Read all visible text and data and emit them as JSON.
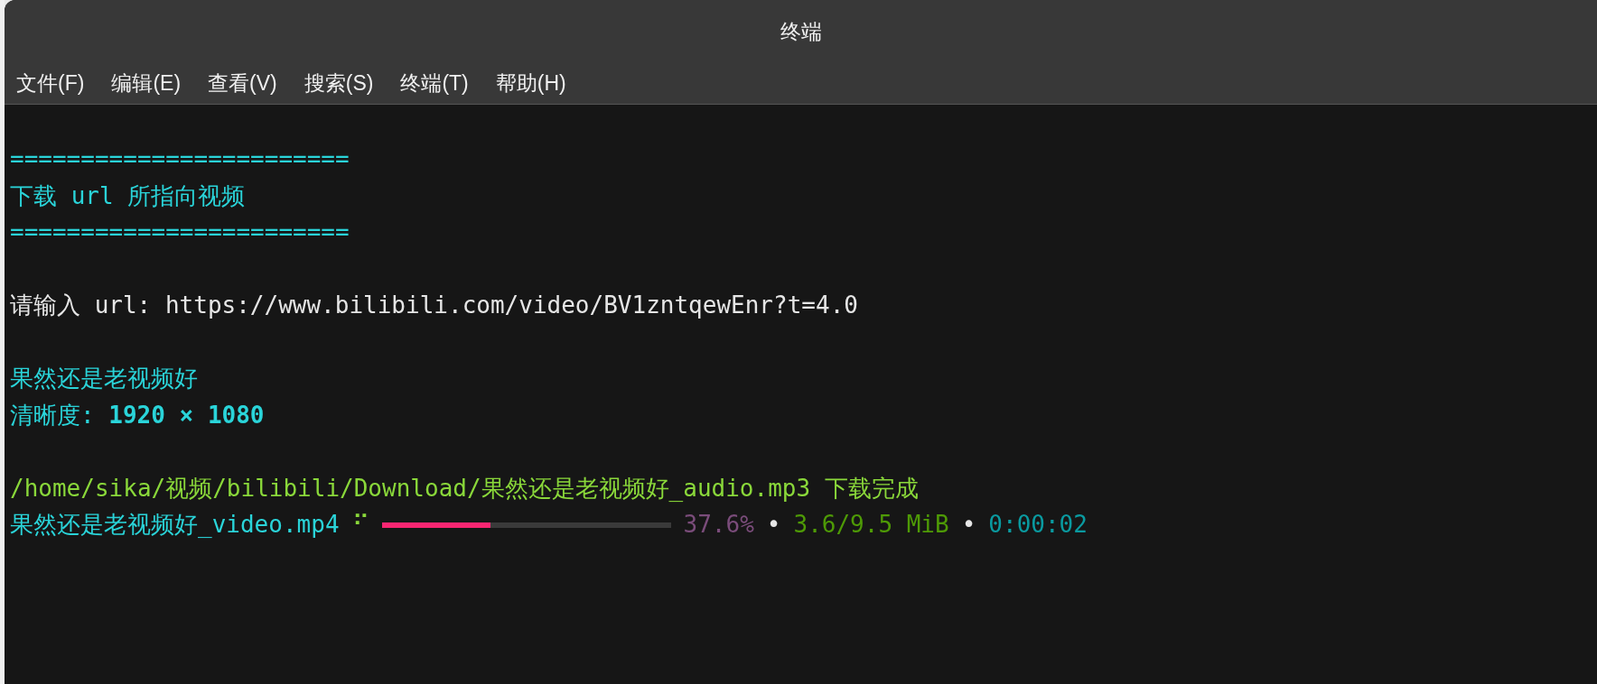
{
  "window": {
    "title": "终端"
  },
  "menu": [
    {
      "label": "文件(F)"
    },
    {
      "label": "编辑(E)"
    },
    {
      "label": "查看(V)"
    },
    {
      "label": "搜索(S)"
    },
    {
      "label": "终端(T)"
    },
    {
      "label": "帮助(H)"
    }
  ],
  "lines": [
    {
      "kind": "blank"
    },
    {
      "kind": "text",
      "segments": [
        {
          "text": "========================",
          "color": "#2ad4d9"
        }
      ]
    },
    {
      "kind": "text",
      "segments": [
        {
          "text": "下载 url 所指向视频",
          "color": "#2ad4d9"
        }
      ]
    },
    {
      "kind": "text",
      "segments": [
        {
          "text": "========================",
          "color": "#2ad4d9"
        }
      ]
    },
    {
      "kind": "blank"
    },
    {
      "kind": "text",
      "segments": [
        {
          "text": "请输入 url: https://www.bilibili.com/video/BV1zntqewEnr?t=4.0",
          "color": "#e6e6e6"
        }
      ]
    },
    {
      "kind": "blank"
    },
    {
      "kind": "text",
      "segments": [
        {
          "text": "果然还是老视频好",
          "color": "#2ad4d9"
        }
      ]
    },
    {
      "kind": "text",
      "segments": [
        {
          "text": "清晰度: **1920 × 1080**",
          "color": "#2ad4d9"
        }
      ]
    },
    {
      "kind": "blank"
    },
    {
      "kind": "text",
      "segments": [
        {
          "text": "/home/sika/视频/bilibili/Download/果然还是老视频好_audio.mp3 下载完成",
          "color": "#8ad83a"
        }
      ]
    },
    {
      "kind": "progress",
      "file": {
        "text": "果然还是老视频好_video.mp4",
        "color": "#2ad4d9"
      },
      "spinner": {
        "text": "⠋",
        "color": "#8ad83a"
      },
      "level": 0.376,
      "percent": {
        "text": "37.6%",
        "color": "#7a4c7a"
      },
      "separators": [
        {
          "text": "•",
          "color": "#e6e6e6"
        },
        {
          "text": "•",
          "color": "#e6e6e6"
        }
      ],
      "size": {
        "text": "3.6/9.5 MiB",
        "color": "#4e9a06"
      },
      "elapsed": {
        "text": "0:00:02",
        "color": "#0a9aa0"
      }
    }
  ]
}
